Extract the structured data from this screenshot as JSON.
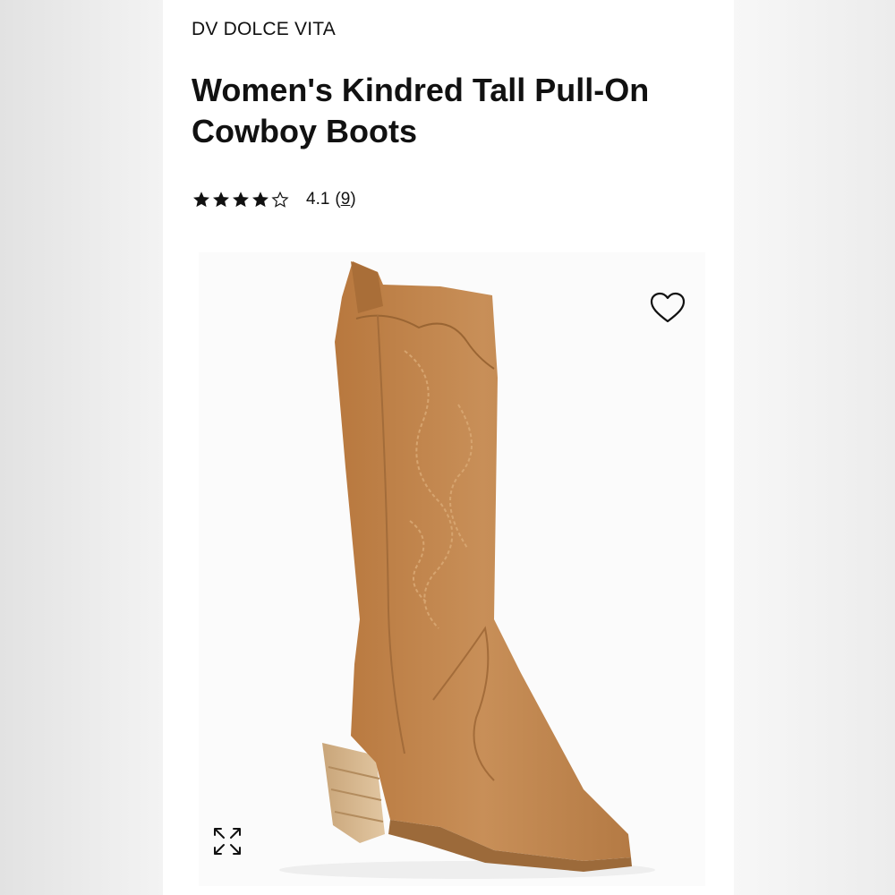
{
  "product": {
    "brand": "DV DOLCE VITA",
    "title": "Women's Kindred Tall Pull-On Cowboy Boots",
    "rating": {
      "stars_filled": 4,
      "stars_total": 5,
      "value": "4.1",
      "count_open": "(",
      "count": "9",
      "count_close": ")"
    },
    "image": {
      "alt": "Tan tall pointed-toe cowboy boot with western stitching and stacked block heel",
      "boot_color": "#c48a52",
      "heel_color": "#d8b98f"
    }
  },
  "icons": {
    "wishlist": "heart-outline-icon",
    "zoom": "expand-arrows-icon",
    "star_filled": "star-filled-icon",
    "star_empty": "star-outline-icon"
  }
}
